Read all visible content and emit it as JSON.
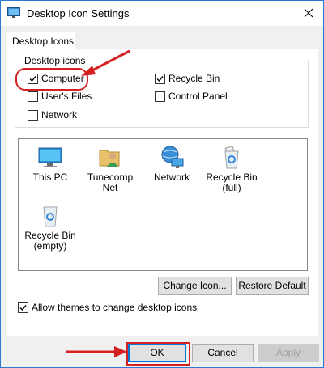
{
  "window": {
    "title": "Desktop Icon Settings",
    "tab": "Desktop Icons"
  },
  "desktop_icons_group": {
    "legend": "Desktop icons",
    "checkboxes": [
      {
        "label": "Computer",
        "checked": true
      },
      {
        "label": "Recycle Bin",
        "checked": true
      },
      {
        "label": "User's Files",
        "checked": false
      },
      {
        "label": "Control Panel",
        "checked": false
      },
      {
        "label": "Network",
        "checked": false
      }
    ]
  },
  "icon_list": [
    {
      "label": "This PC",
      "icon": "this-pc-icon"
    },
    {
      "label": "Tunecomp Net",
      "icon": "user-folder-icon"
    },
    {
      "label": "Network",
      "icon": "network-icon"
    },
    {
      "label": "Recycle Bin (full)",
      "icon": "recycle-bin-full-icon"
    },
    {
      "label": "Recycle Bin (empty)",
      "icon": "recycle-bin-empty-icon"
    }
  ],
  "buttons": {
    "change_icon": "Change Icon...",
    "restore_default": "Restore Default",
    "ok": "OK",
    "cancel": "Cancel",
    "apply": "Apply"
  },
  "allow_themes": {
    "label": "Allow themes to change desktop icons",
    "checked": true
  },
  "colors": {
    "annotation_red": "#d42020",
    "window_border": "#2b79d4",
    "focus_blue": "#0078d7"
  }
}
